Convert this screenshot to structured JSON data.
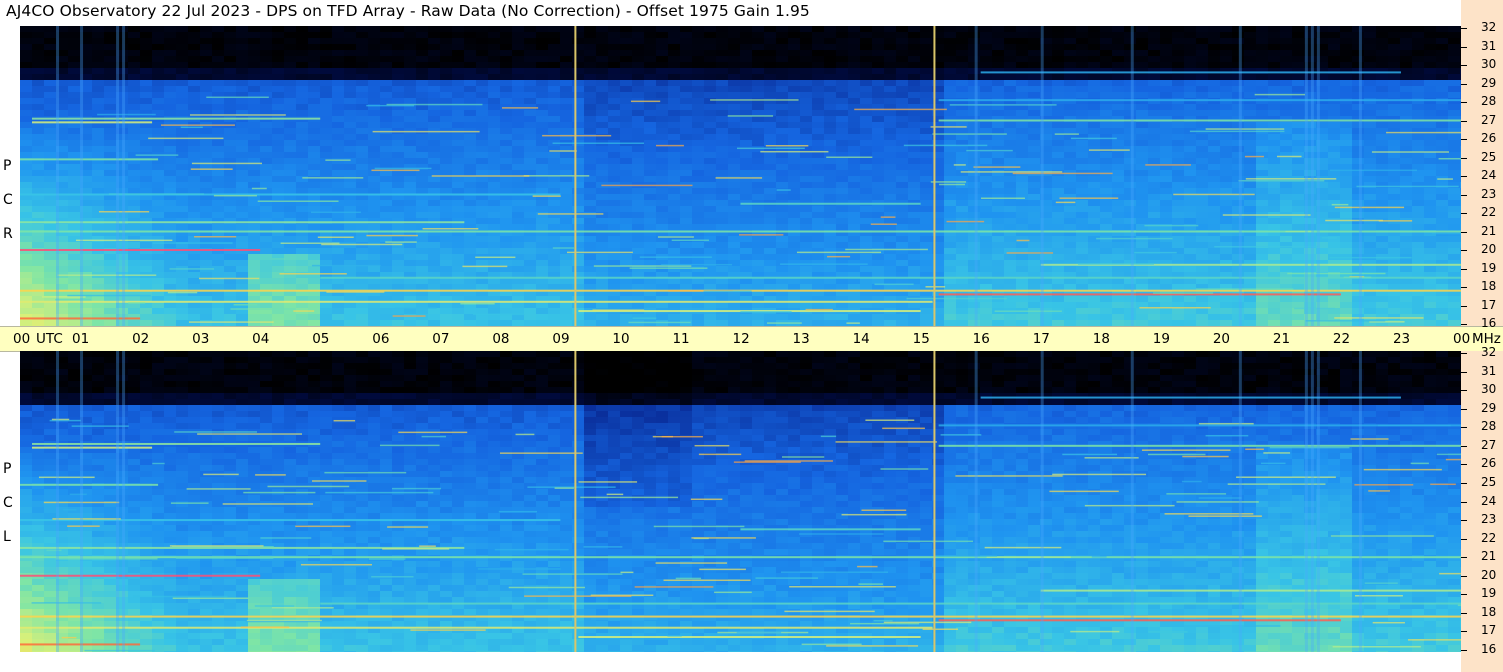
{
  "title": "AJ4CO Observatory  22 Jul 2023  -  DPS on TFD Array  -  Raw Data (No Correction)  -  Offset 1975  Gain 1.95",
  "chart_data": {
    "type": "heatmap",
    "title": "AJ4CO Observatory  22 Jul 2023  -  DPS on TFD Array  -  Raw Data (No Correction)  -  Offset 1975  Gain 1.95",
    "x_axis": {
      "unit_label": "UTC",
      "range_hours": [
        0,
        24
      ],
      "tick_labels": [
        "00",
        "01",
        "02",
        "03",
        "04",
        "05",
        "06",
        "07",
        "08",
        "09",
        "10",
        "11",
        "12",
        "13",
        "14",
        "15",
        "16",
        "17",
        "18",
        "19",
        "20",
        "21",
        "22",
        "23",
        "00"
      ]
    },
    "y_axis": {
      "unit_label": "MHz",
      "range_mhz": [
        16,
        32
      ],
      "tick_labels": [
        "32",
        "31",
        "30",
        "29",
        "28",
        "27",
        "26",
        "25",
        "24",
        "23",
        "22",
        "21",
        "20",
        "19",
        "18",
        "17",
        "16"
      ]
    },
    "panels": [
      {
        "name": "R C P",
        "letters": [
          "R",
          "C",
          "P"
        ]
      },
      {
        "name": "L C P",
        "letters": [
          "L",
          "C",
          "P"
        ]
      }
    ],
    "marker_lines_utc": [
      9.25,
      15.23
    ],
    "colormap": [
      "#000000",
      "#000a3c",
      "#0a2f9c",
      "#1565e0",
      "#1f94f0",
      "#38c4e6",
      "#7ee5a6",
      "#d8f07a",
      "#ffd34a",
      "#ff6a3a",
      "#ff2fb0"
    ]
  }
}
